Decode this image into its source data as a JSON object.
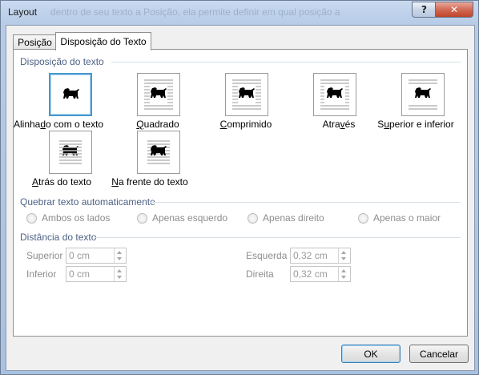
{
  "window": {
    "title": "Layout",
    "background_text": "dentro de seu texto a Posição, ela permite definir em qual posição a",
    "help_label": "?",
    "close_label": "✕"
  },
  "tabs": [
    {
      "label": "Posição",
      "active": false
    },
    {
      "label": "Disposição do Texto",
      "active": true
    }
  ],
  "wrapping": {
    "section": "Disposição do texto",
    "options": [
      {
        "pre": "Alinha",
        "u": "d",
        "post": "o com o texto",
        "icon": "inline-wrap-icon",
        "selected": true
      },
      {
        "pre": "",
        "u": "Q",
        "post": "uadrado",
        "icon": "square-wrap-icon",
        "selected": false
      },
      {
        "pre": "",
        "u": "C",
        "post": "omprimido",
        "icon": "tight-wrap-icon",
        "selected": false
      },
      {
        "pre": "Atra",
        "u": "v",
        "post": "és",
        "icon": "through-wrap-icon",
        "selected": false
      },
      {
        "pre": "S",
        "u": "u",
        "post": "perior e inferior",
        "icon": "top-bottom-wrap-icon",
        "selected": false
      },
      {
        "pre": "",
        "u": "A",
        "post": "trás do texto",
        "icon": "behind-text-wrap-icon",
        "selected": false
      },
      {
        "pre": "",
        "u": "N",
        "post": "a frente do texto",
        "icon": "in-front-wrap-icon",
        "selected": false
      }
    ]
  },
  "wrap_text": {
    "section": "Quebrar texto automaticamente",
    "options": [
      "Ambos os lados",
      "Apenas esquerdo",
      "Apenas direito",
      "Apenas o maior"
    ]
  },
  "distance": {
    "section": "Distância do texto",
    "superior_label": "Superior",
    "superior_value": "0 cm",
    "inferior_label": "Inferior",
    "inferior_value": "0 cm",
    "esquerda_label": "Esquerda",
    "esquerda_value": "0,32 cm",
    "direita_label": "Direita",
    "direita_value": "0,32 cm"
  },
  "buttons": {
    "ok": "OK",
    "cancel": "Cancelar"
  },
  "colors": {
    "section_text": "#4d6185",
    "selection_border": "#4598d0"
  }
}
